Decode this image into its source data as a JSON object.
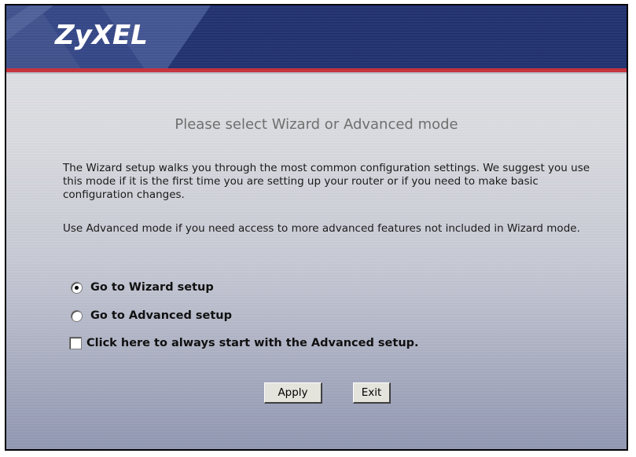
{
  "header": {
    "logo": "ZyXEL",
    "background_color": "#1a2b6c",
    "accent_line_color": "#c52a35"
  },
  "content": {
    "heading": "Please select Wizard or Advanced mode",
    "paragraph1": "The Wizard setup walks you through the most common configuration settings. We suggest you use this mode if it is the first time you are setting up your router or if you need to make basic configuration changes.",
    "paragraph2": "Use Advanced mode if you need access to more advanced features not included in Wizard mode."
  },
  "options": {
    "wizard": {
      "label": "Go to Wizard setup",
      "checked": true
    },
    "advanced": {
      "label": "Go to Advanced setup",
      "checked": false
    },
    "always_advanced": {
      "label": "Click here to always start with the Advanced setup.",
      "checked": false
    }
  },
  "buttons": {
    "apply": "Apply",
    "exit": "Exit"
  }
}
